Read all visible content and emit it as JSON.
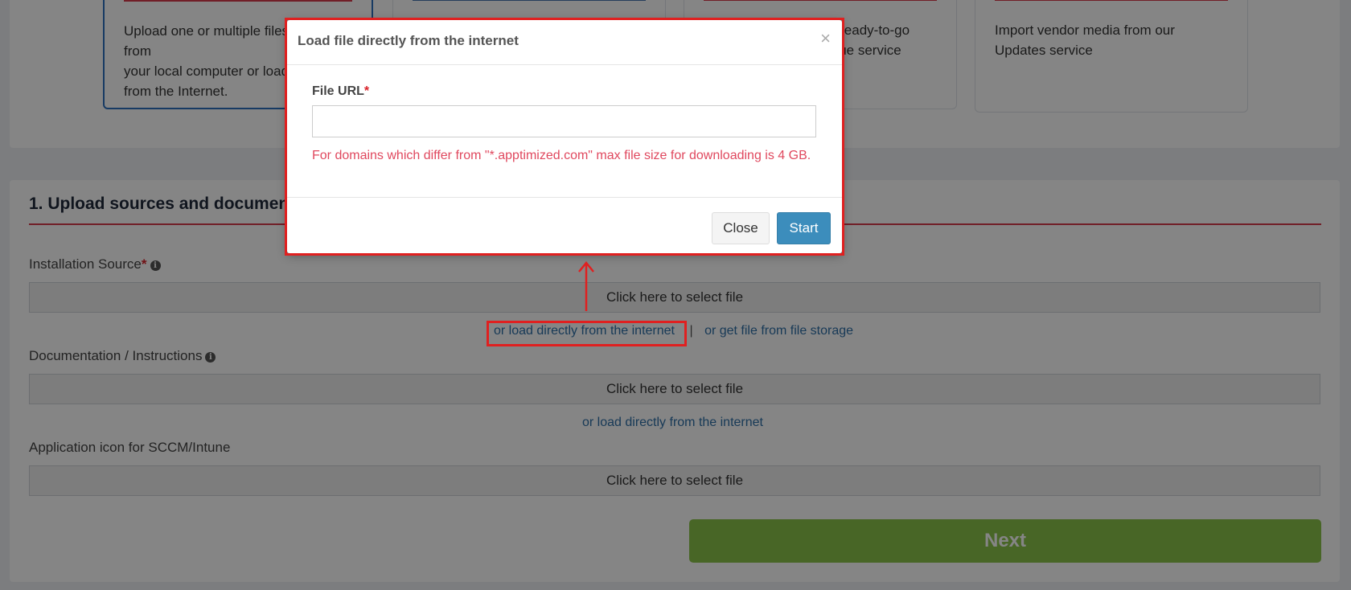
{
  "top_options": {
    "card1_text": "Upload one or multiple files from\nyour local computer or load\nfrom the Internet.",
    "card3_text": "Choose from over our ready-to-go\napps from our Catalogue service",
    "card4_text": "Import vendor media from our\nUpdates service"
  },
  "section": {
    "title": "1. Upload sources and documentation"
  },
  "fields": {
    "installation_label": "Installation Source",
    "installation_box": "Click here to select file",
    "installation_link_internet": "or load directly from the internet",
    "installation_separator": "|",
    "installation_link_storage": "or get file from file storage",
    "documentation_label": "Documentation / Instructions",
    "documentation_box": "Click here to select file",
    "documentation_link_internet": "or load directly from the internet",
    "icon_label": "Application icon for SCCM/Intune",
    "icon_box": "Click here to select file",
    "required_marker": "*",
    "info_glyph": "i"
  },
  "next_button": "Next",
  "modal": {
    "title": "Load file directly from the internet",
    "close_glyph": "×",
    "field_label": "File URL",
    "required_marker": "*",
    "url_value": "",
    "note": "For domains which differ from \"*.apptimized.com\" max file size for downloading is 4 GB.",
    "close_button": "Close",
    "start_button": "Start"
  },
  "colors": {
    "accent_red": "#d93a4c",
    "annotation_red": "#e02020",
    "link_blue": "#2e6fa8",
    "primary_button": "#3c8dbc",
    "next_button": "#8bc34a",
    "note_text": "#e0485e"
  }
}
